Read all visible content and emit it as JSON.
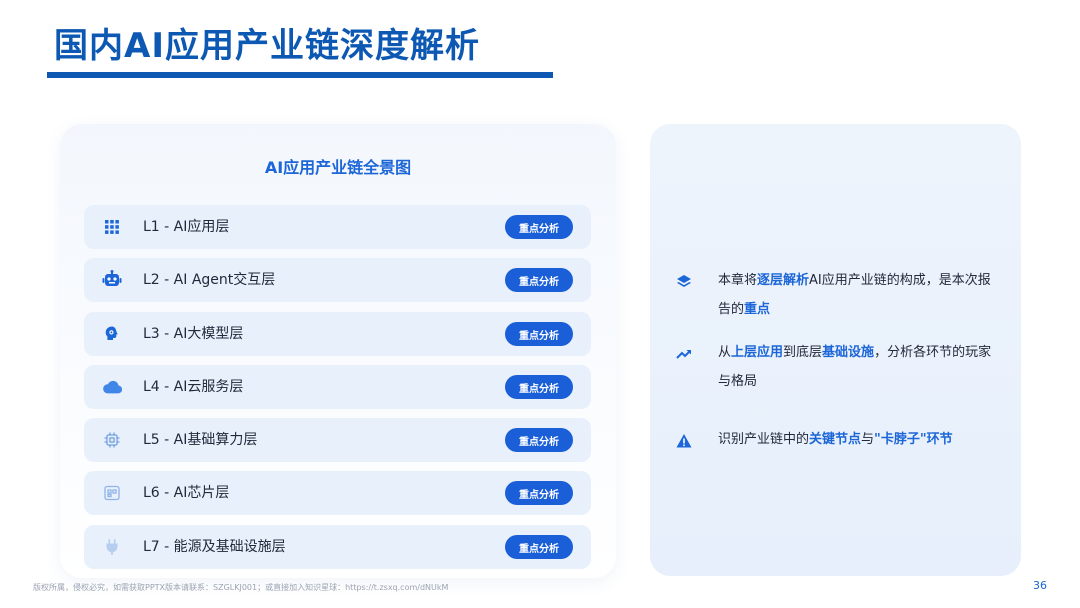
{
  "page": {
    "title": "国内AI应用产业链深度解析",
    "page_number": "36"
  },
  "left_panel": {
    "title": "AI应用产业链全景图",
    "layers": [
      {
        "label": "L1 - AI应用层",
        "badge": "重点分析",
        "icon": "grid-icon"
      },
      {
        "label": "L2 - AI Agent交互层",
        "badge": "重点分析",
        "icon": "robot-icon"
      },
      {
        "label": "L3 - AI大模型层",
        "badge": "重点分析",
        "icon": "brain-icon"
      },
      {
        "label": "L4 - AI云服务层",
        "badge": "重点分析",
        "icon": "cloud-icon"
      },
      {
        "label": "L5 - AI基础算力层",
        "badge": "重点分析",
        "icon": "cpu-icon"
      },
      {
        "label": "L6 - AI芯片层",
        "badge": "重点分析",
        "icon": "chip-icon"
      },
      {
        "label": "L7 - 能源及基础设施层",
        "badge": "重点分析",
        "icon": "plug-icon"
      }
    ]
  },
  "right_panel": {
    "points": [
      {
        "icon": "layers-icon",
        "parts": [
          "本章将",
          "逐层解析",
          "AI应用产业链的构成，是本次报告的",
          "重点",
          ""
        ]
      },
      {
        "icon": "trend-up-icon",
        "parts": [
          "从",
          "上层应用",
          "到底层",
          "基础设施",
          "，分析各环节的玩家与格局"
        ]
      },
      {
        "icon": "warning-icon",
        "parts": [
          "识别产业链中的",
          "关键节点",
          "与",
          "\"卡脖子\"环节",
          ""
        ]
      }
    ]
  },
  "footer": {
    "text": "版权所属，侵权必究，如需获取PPTX版本请联系：SZGLKJ001；或直接加入知识星球：https://t.zsxq.com/dNUkM"
  },
  "colors": {
    "primary": "#0d58b3",
    "accent": "#1d66d8",
    "badge": "#1a5fd8",
    "row_bg": "#e8f0fc"
  }
}
